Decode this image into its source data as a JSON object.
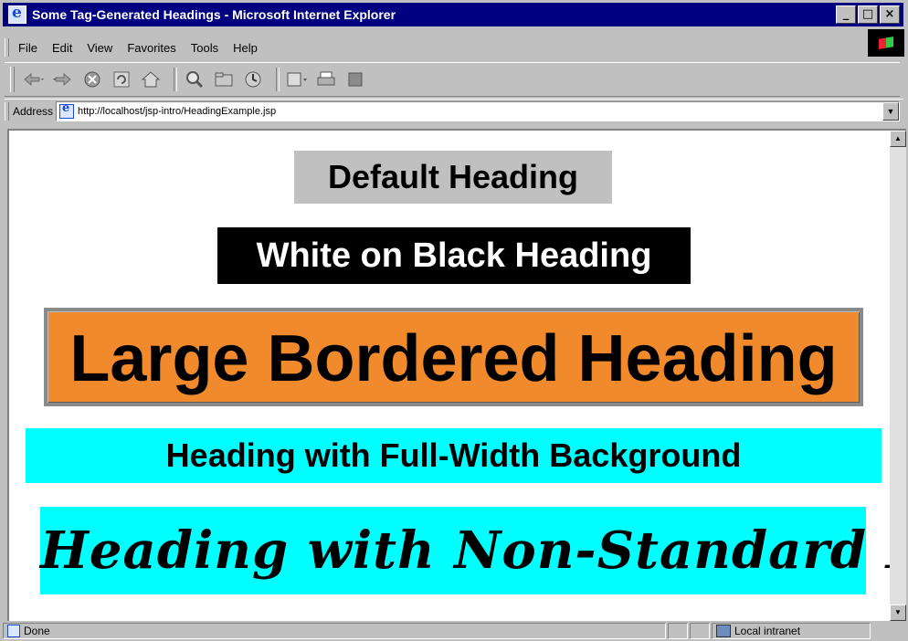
{
  "window": {
    "title": "Some Tag-Generated Headings - Microsoft Internet Explorer",
    "minimize": "_",
    "maximize": "□",
    "close": "×"
  },
  "menu": {
    "items": [
      {
        "label": "File"
      },
      {
        "label": "Edit"
      },
      {
        "label": "View"
      },
      {
        "label": "Favorites"
      },
      {
        "label": "Tools"
      },
      {
        "label": "Help"
      }
    ]
  },
  "address": {
    "label": "Address",
    "url": "http://localhost/jsp-intro/HeadingExample.jsp"
  },
  "headings": {
    "default": "Default Heading",
    "white_on_black": "White on Black Heading",
    "large_bordered": "Large Bordered Heading",
    "full_width": "Heading with Full-Width Background",
    "non_standard_font": "Heading with Non-Standard Font"
  },
  "colors": {
    "default_bg": "#c0c0c0",
    "black_bg": "#000000",
    "orange_bg": "#f08a2c",
    "cyan_bg": "#00ffff"
  },
  "status": {
    "text": "Done",
    "zone": "Local intranet"
  }
}
